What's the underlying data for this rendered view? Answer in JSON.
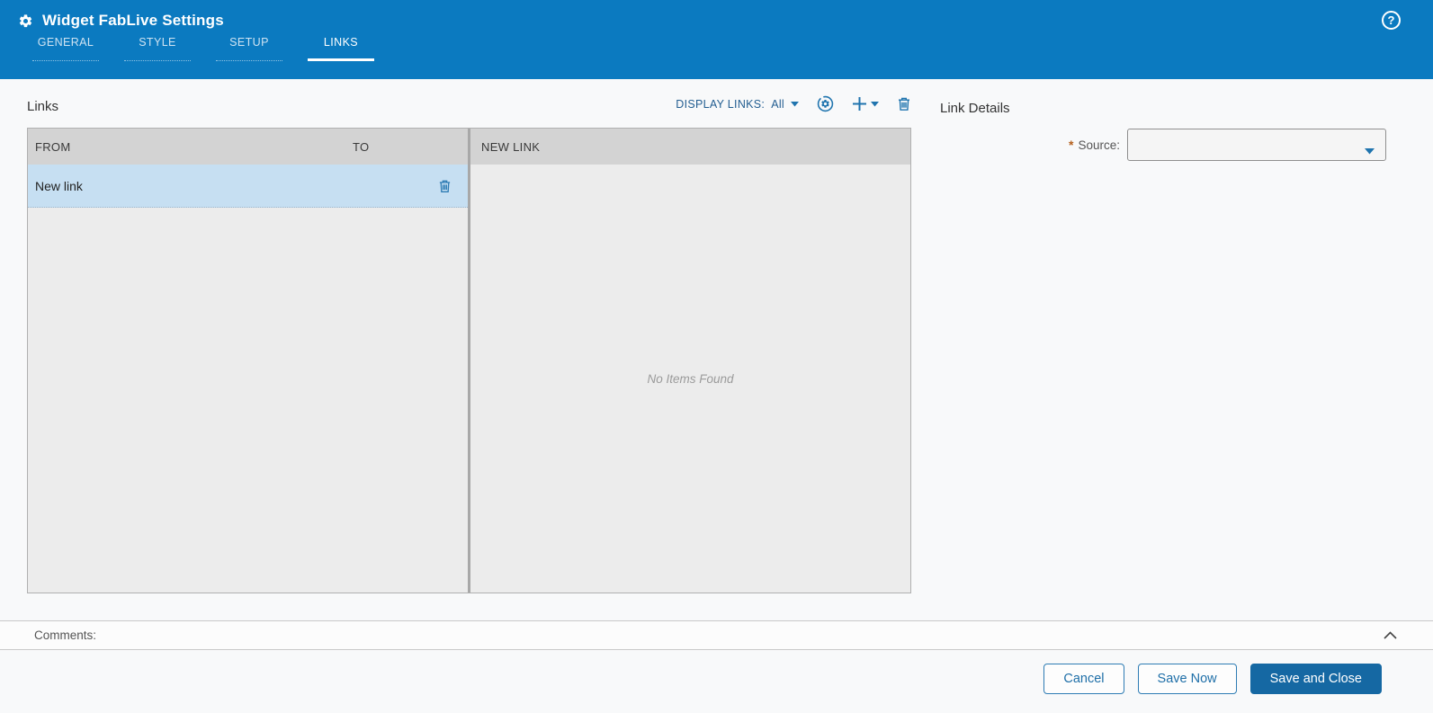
{
  "header": {
    "title": "Widget FabLive Settings",
    "tabs": [
      {
        "label": "GENERAL",
        "active": false
      },
      {
        "label": "STYLE",
        "active": false
      },
      {
        "label": "SETUP",
        "active": false
      },
      {
        "label": "LINKS",
        "active": true
      }
    ]
  },
  "links_section": {
    "title": "Links",
    "display_links_label": "DISPLAY LINKS:",
    "display_links_value": "All"
  },
  "table": {
    "columns": {
      "from": "FROM",
      "to": "TO",
      "new_link": "NEW LINK"
    },
    "rows": [
      {
        "from": "New link"
      }
    ],
    "empty_message": "No Items Found"
  },
  "details": {
    "title": "Link Details",
    "required_marker": "*",
    "source_label": "Source:",
    "source_value": ""
  },
  "comments": {
    "label": "Comments:"
  },
  "footer": {
    "cancel": "Cancel",
    "save_now": "Save Now",
    "save_and_close": "Save and Close"
  },
  "icons": {
    "help_glyph": "?"
  },
  "colors": {
    "header_bg": "#0b7ac0",
    "accent_blue": "#1f74ae",
    "selected_row_bg": "#c6dff2",
    "table_header_bg": "#d3d3d3",
    "primary_button_bg": "#1568a3",
    "required_marker_color": "#b4601d"
  }
}
